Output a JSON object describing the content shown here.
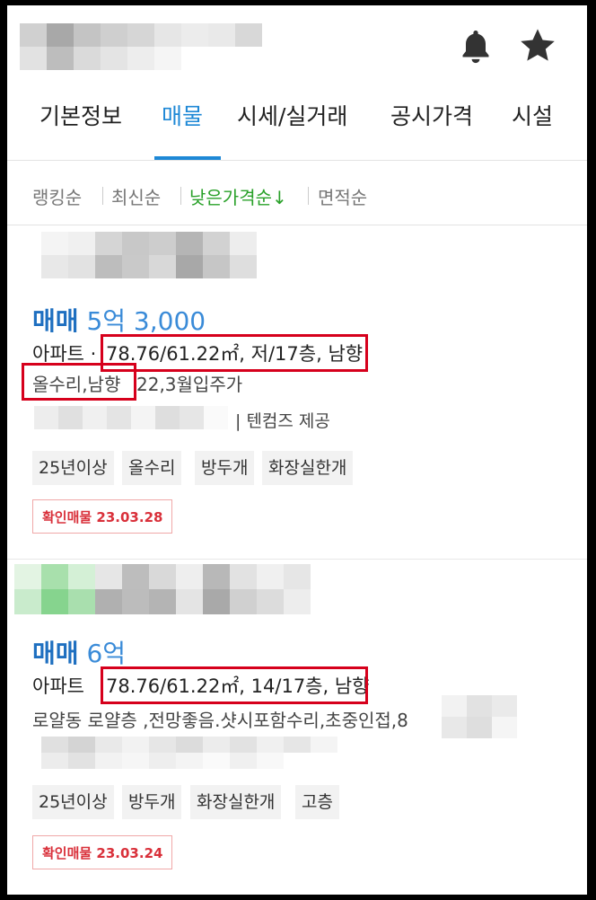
{
  "header": {
    "bell_icon": "bell-icon",
    "star_icon": "star-icon"
  },
  "tabs": [
    {
      "label": "기본정보"
    },
    {
      "label": "매물"
    },
    {
      "label": "시세/실거래"
    },
    {
      "label": "공시가격"
    },
    {
      "label": "시설"
    }
  ],
  "sort": [
    {
      "label": "랭킹순"
    },
    {
      "label": "최신순"
    },
    {
      "label": "낮은가격순↓"
    },
    {
      "label": "면적순"
    }
  ],
  "listings": [
    {
      "deal_type": "매매",
      "price": "5억 3,000",
      "property_type": "아파트 ·",
      "specs": "78.76/61.22㎡, 저/17층, 남향",
      "description_highlight": "올수리,남향",
      "description_rest": "22,3월입주가",
      "provider": "| 텐컴즈 제공",
      "tags": [
        "25년이상",
        "올수리",
        "방두개",
        "화장실한개"
      ],
      "confirmed": "확인매물 23.03.28"
    },
    {
      "deal_type": "매매",
      "price": "6억",
      "property_type": "아파트",
      "specs": "78.76/61.22㎡, 14/17층, 남향",
      "description": "로얄동 로얄층 ,전망좋음.샷시포함수리,초중인접,8",
      "tags": [
        "25년이상",
        "방두개",
        "화장실한개",
        "고층"
      ],
      "confirmed": "확인매물 23.03.24"
    }
  ]
}
